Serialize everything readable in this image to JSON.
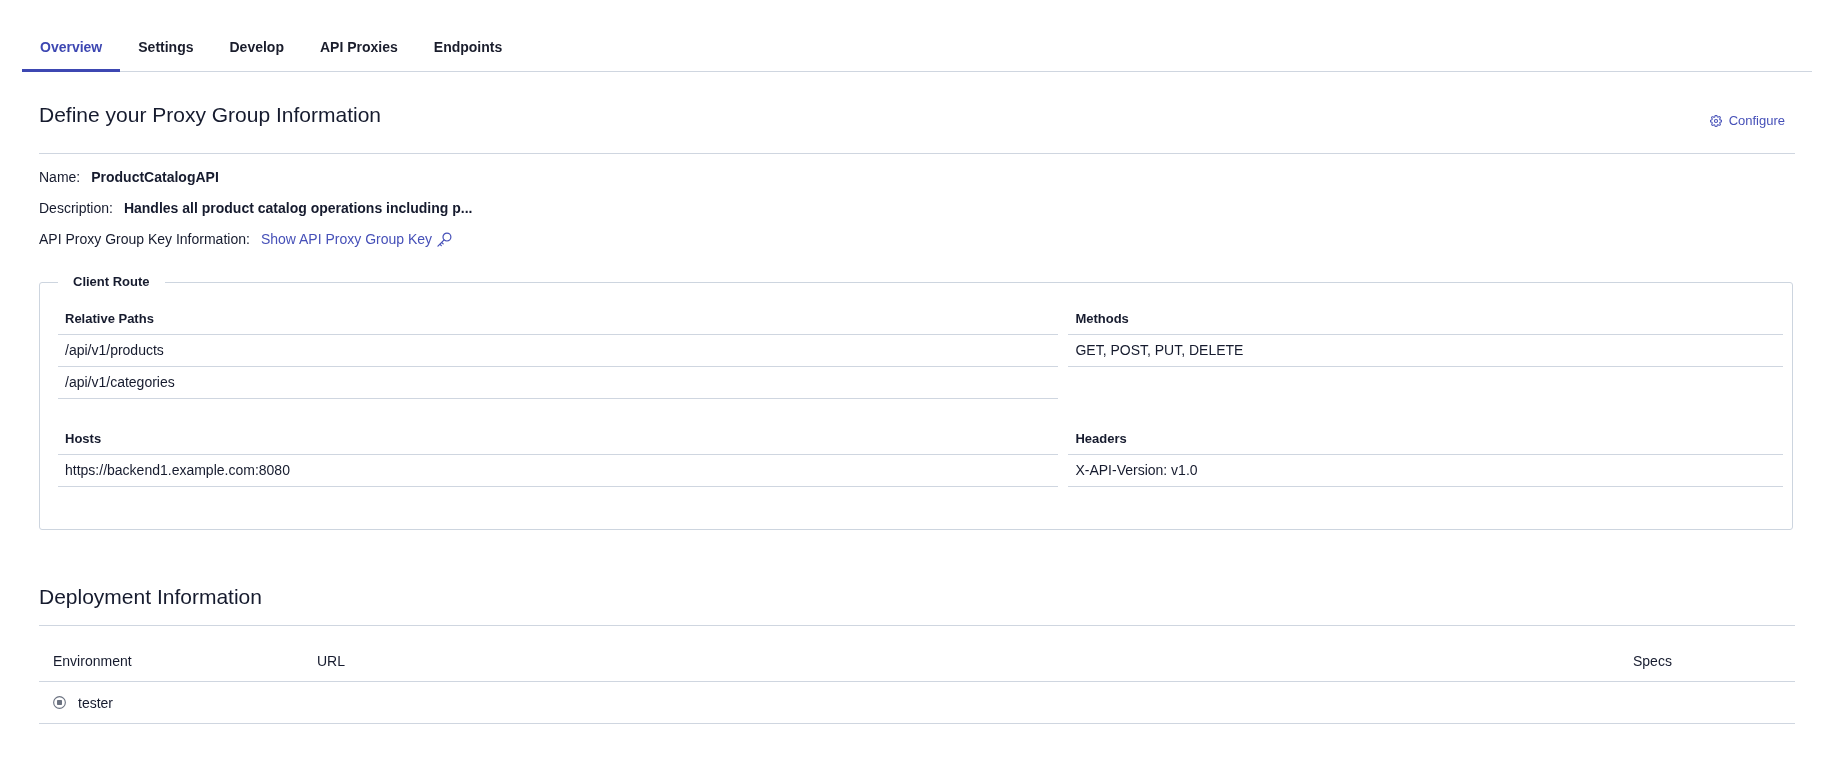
{
  "tabs": [
    {
      "label": "Overview",
      "selected": true
    },
    {
      "label": "Settings",
      "selected": false
    },
    {
      "label": "Develop",
      "selected": false
    },
    {
      "label": "API Proxies",
      "selected": false
    },
    {
      "label": "Endpoints",
      "selected": false
    }
  ],
  "proxy_group": {
    "title": "Define your Proxy Group Information",
    "configure_button": "Configure",
    "fields": [
      {
        "label": "Name:",
        "value": "ProductCatalogAPI",
        "kind": "text"
      },
      {
        "label": "Description:",
        "value": "Handles all product catalog operations including p...",
        "kind": "text"
      },
      {
        "label": "API Proxy Group Key Information:",
        "value": "Show API Proxy Group Key",
        "kind": "link"
      }
    ]
  },
  "client_route": {
    "legend": "Client Route",
    "tables": [
      {
        "header": "Relative Paths",
        "rows": [
          "/api/v1/products",
          "/api/v1/categories"
        ]
      },
      {
        "header": "Methods",
        "rows": [
          "GET, POST, PUT, DELETE"
        ]
      },
      {
        "header": "Hosts",
        "rows": [
          "https://backend1.example.com:8080"
        ]
      },
      {
        "header": "Headers",
        "rows": [
          "X-API-Version: v1.0"
        ]
      }
    ]
  },
  "deployment": {
    "title": "Deployment Information",
    "columns": [
      "Environment",
      "URL",
      "Specs"
    ],
    "rows": [
      {
        "environment": "tester"
      }
    ]
  }
}
